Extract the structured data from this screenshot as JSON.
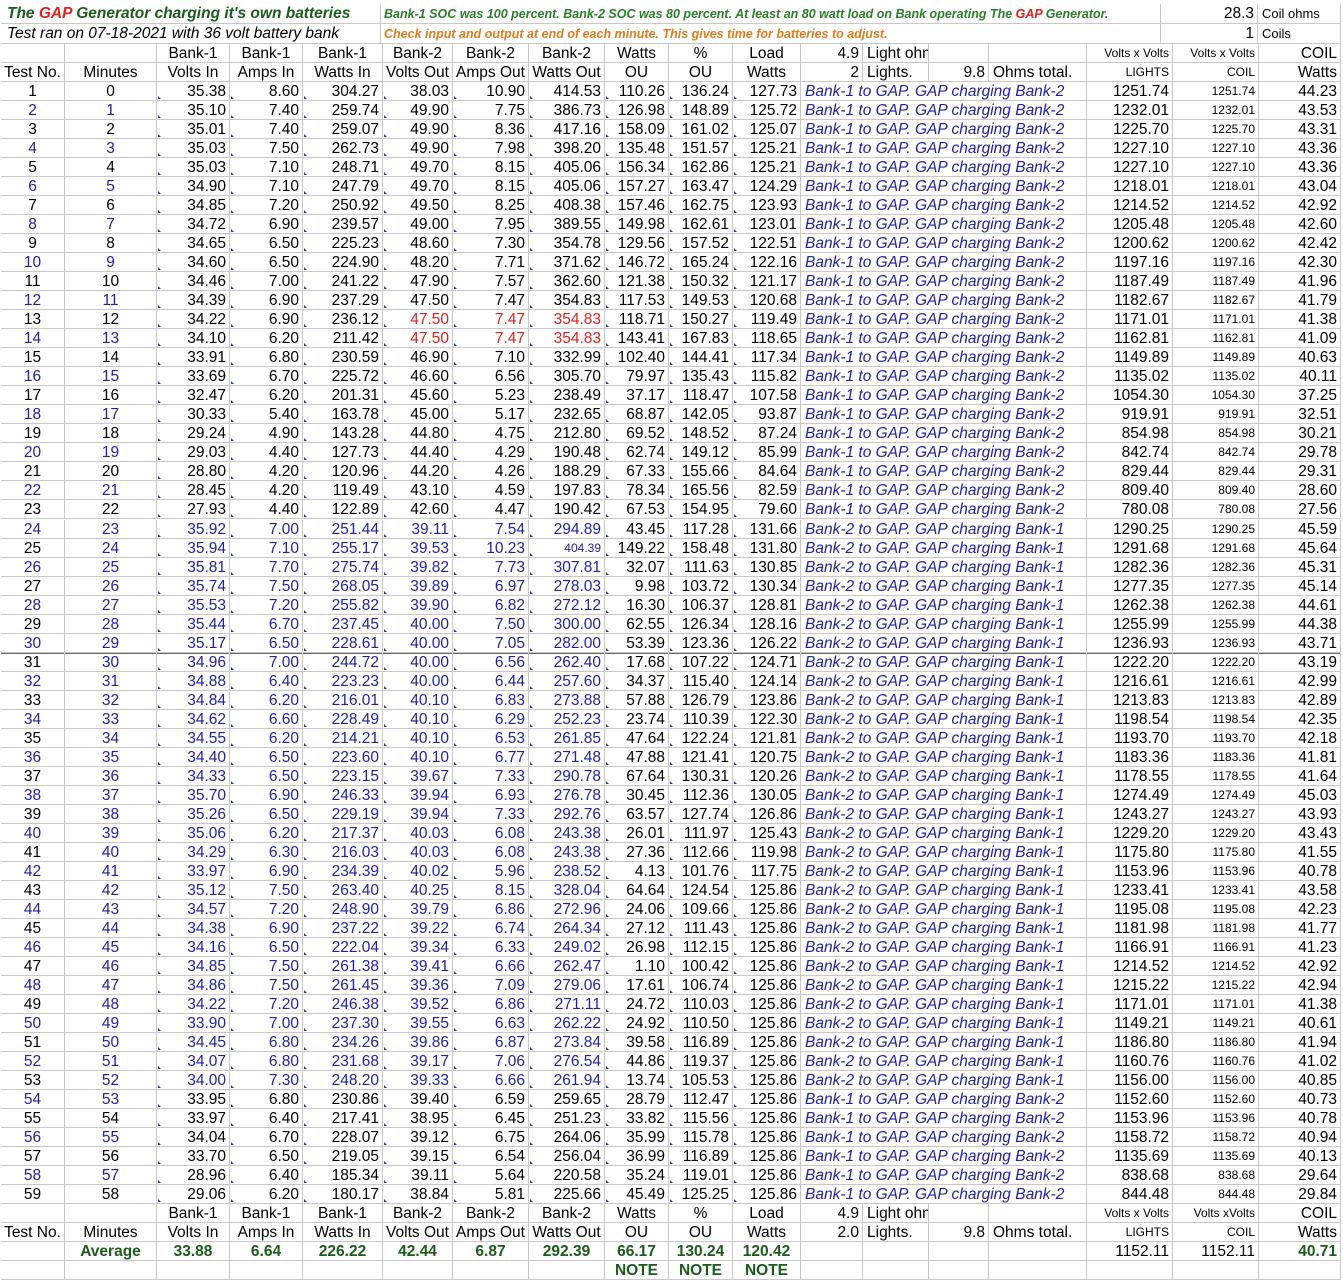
{
  "header": {
    "title_prefix": "The ",
    "title_gap": "GAP",
    "title_suffix": " Generator charging it's own batteries",
    "subtitle": "Test ran on 07-18-2021 with 36 volt battery bank",
    "note1_a": "Bank-1 SOC was 100 percent. Bank-2 SOC was 80 percent.  At least an 80 watt load on Bank operating The ",
    "note1_gap": "GAP",
    "note1_b": " Generator.",
    "note2": "Check input and output at end of each minute. This gives time for batteries to adjust.",
    "coil_ohms_value": "28.3",
    "coil_ohms_label": "Coil ohms",
    "coils_value": "1",
    "coils_label": "Coils"
  },
  "colheaders": {
    "top": [
      "",
      "",
      "Bank-1",
      "Bank-1",
      "Bank-1",
      "Bank-2",
      "Bank-2",
      "Bank-2",
      "Watts",
      "%",
      "Load",
      "4.9",
      "Light ohms.",
      "",
      "",
      "Volts x Volts",
      "Volts x Volts",
      "COIL"
    ],
    "bottom": [
      "Test No.",
      "Minutes",
      "Volts In",
      "Amps In",
      "Watts In",
      "Volts Out",
      "Amps Out",
      "Watts Out",
      "OU",
      "OU",
      "Watts",
      "2",
      "Lights.",
      "9.8",
      "Ohms total.",
      "LIGHTS",
      "COIL",
      "Watts"
    ]
  },
  "rows": [
    [
      "1",
      "0",
      "35.38",
      "8.60",
      "304.27",
      "38.03",
      "10.90",
      "414.53",
      "110.26",
      "136.24",
      "127.73",
      "Bank-1 to GAP. GAP charging Bank-2",
      "1251.74",
      "1251.74",
      "44.23"
    ],
    [
      "2",
      "1",
      "35.10",
      "7.40",
      "259.74",
      "49.90",
      "7.75",
      "386.73",
      "126.98",
      "148.89",
      "125.72",
      "Bank-1 to GAP. GAP charging Bank-2",
      "1232.01",
      "1232.01",
      "43.53"
    ],
    [
      "3",
      "2",
      "35.01",
      "7.40",
      "259.07",
      "49.90",
      "8.36",
      "417.16",
      "158.09",
      "161.02",
      "125.07",
      "Bank-1 to GAP. GAP charging Bank-2",
      "1225.70",
      "1225.70",
      "43.31"
    ],
    [
      "4",
      "3",
      "35.03",
      "7.50",
      "262.73",
      "49.90",
      "7.98",
      "398.20",
      "135.48",
      "151.57",
      "125.21",
      "Bank-1 to GAP. GAP charging Bank-2",
      "1227.10",
      "1227.10",
      "43.36"
    ],
    [
      "5",
      "4",
      "35.03",
      "7.10",
      "248.71",
      "49.70",
      "8.15",
      "405.06",
      "156.34",
      "162.86",
      "125.21",
      "Bank-1 to GAP. GAP charging Bank-2",
      "1227.10",
      "1227.10",
      "43.36"
    ],
    [
      "6",
      "5",
      "34.90",
      "7.10",
      "247.79",
      "49.70",
      "8.15",
      "405.06",
      "157.27",
      "163.47",
      "124.29",
      "Bank-1 to GAP. GAP charging Bank-2",
      "1218.01",
      "1218.01",
      "43.04"
    ],
    [
      "7",
      "6",
      "34.85",
      "7.20",
      "250.92",
      "49.50",
      "8.25",
      "408.38",
      "157.46",
      "162.75",
      "123.93",
      "Bank-1 to GAP. GAP charging Bank-2",
      "1214.52",
      "1214.52",
      "42.92"
    ],
    [
      "8",
      "7",
      "34.72",
      "6.90",
      "239.57",
      "49.00",
      "7.95",
      "389.55",
      "149.98",
      "162.61",
      "123.01",
      "Bank-1 to GAP. GAP charging Bank-2",
      "1205.48",
      "1205.48",
      "42.60"
    ],
    [
      "9",
      "8",
      "34.65",
      "6.50",
      "225.23",
      "48.60",
      "7.30",
      "354.78",
      "129.56",
      "157.52",
      "122.51",
      "Bank-1 to GAP. GAP charging Bank-2",
      "1200.62",
      "1200.62",
      "42.42"
    ],
    [
      "10",
      "9",
      "34.60",
      "6.50",
      "224.90",
      "48.20",
      "7.71",
      "371.62",
      "146.72",
      "165.24",
      "122.16",
      "Bank-1 to GAP. GAP charging Bank-2",
      "1197.16",
      "1197.16",
      "42.30"
    ],
    [
      "11",
      "10",
      "34.46",
      "7.00",
      "241.22",
      "47.90",
      "7.57",
      "362.60",
      "121.38",
      "150.32",
      "121.17",
      "Bank-1 to GAP. GAP charging Bank-2",
      "1187.49",
      "1187.49",
      "41.96"
    ],
    [
      "12",
      "11",
      "34.39",
      "6.90",
      "237.29",
      "47.50",
      "7.47",
      "354.83",
      "117.53",
      "149.53",
      "120.68",
      "Bank-1 to GAP. GAP charging Bank-2",
      "1182.67",
      "1182.67",
      "41.79"
    ],
    [
      "13",
      "12",
      "34.22",
      "6.90",
      "236.12",
      "47.50",
      "7.47",
      "354.83",
      "118.71",
      "150.27",
      "119.49",
      "Bank-1 to GAP. GAP charging Bank-2",
      "1171.01",
      "1171.01",
      "41.38"
    ],
    [
      "14",
      "13",
      "34.10",
      "6.20",
      "211.42",
      "47.50",
      "7.47",
      "354.83",
      "143.41",
      "167.83",
      "118.65",
      "Bank-1 to GAP. GAP charging Bank-2",
      "1162.81",
      "1162.81",
      "41.09"
    ],
    [
      "15",
      "14",
      "33.91",
      "6.80",
      "230.59",
      "46.90",
      "7.10",
      "332.99",
      "102.40",
      "144.41",
      "117.34",
      "Bank-1 to GAP. GAP charging Bank-2",
      "1149.89",
      "1149.89",
      "40.63"
    ],
    [
      "16",
      "15",
      "33.69",
      "6.70",
      "225.72",
      "46.60",
      "6.56",
      "305.70",
      "79.97",
      "135.43",
      "115.82",
      "Bank-1 to GAP. GAP charging Bank-2",
      "1135.02",
      "1135.02",
      "40.11"
    ],
    [
      "17",
      "16",
      "32.47",
      "6.20",
      "201.31",
      "45.60",
      "5.23",
      "238.49",
      "37.17",
      "118.47",
      "107.58",
      "Bank-1 to GAP. GAP charging Bank-2",
      "1054.30",
      "1054.30",
      "37.25"
    ],
    [
      "18",
      "17",
      "30.33",
      "5.40",
      "163.78",
      "45.00",
      "5.17",
      "232.65",
      "68.87",
      "142.05",
      "93.87",
      "Bank-1 to GAP. GAP charging Bank-2",
      "919.91",
      "919.91",
      "32.51"
    ],
    [
      "19",
      "18",
      "29.24",
      "4.90",
      "143.28",
      "44.80",
      "4.75",
      "212.80",
      "69.52",
      "148.52",
      "87.24",
      "Bank-1 to GAP. GAP charging Bank-2",
      "854.98",
      "854.98",
      "30.21"
    ],
    [
      "20",
      "19",
      "29.03",
      "4.40",
      "127.73",
      "44.40",
      "4.29",
      "190.48",
      "62.74",
      "149.12",
      "85.99",
      "Bank-1 to GAP. GAP charging Bank-2",
      "842.74",
      "842.74",
      "29.78"
    ],
    [
      "21",
      "20",
      "28.80",
      "4.20",
      "120.96",
      "44.20",
      "4.26",
      "188.29",
      "67.33",
      "155.66",
      "84.64",
      "Bank-1 to GAP. GAP charging Bank-2",
      "829.44",
      "829.44",
      "29.31"
    ],
    [
      "22",
      "21",
      "28.45",
      "4.20",
      "119.49",
      "43.10",
      "4.59",
      "197.83",
      "78.34",
      "165.56",
      "82.59",
      "Bank-1 to GAP. GAP charging Bank-2",
      "809.40",
      "809.40",
      "28.60"
    ],
    [
      "23",
      "22",
      "27.93",
      "4.40",
      "122.89",
      "42.60",
      "4.47",
      "190.42",
      "67.53",
      "154.95",
      "79.60",
      "Bank-1 to GAP. GAP charging Bank-2",
      "780.08",
      "780.08",
      "27.56"
    ],
    [
      "24",
      "23",
      "35.92",
      "7.00",
      "251.44",
      "39.11",
      "7.54",
      "294.89",
      "43.45",
      "117.28",
      "131.66",
      "Bank-2 to GAP. GAP charging Bank-1",
      "1290.25",
      "1290.25",
      "45.59"
    ],
    [
      "25",
      "24",
      "35.94",
      "7.10",
      "255.17",
      "39.53",
      "10.23",
      "404.39",
      "149.22",
      "158.48",
      "131.80",
      "Bank-2 to GAP. GAP charging Bank-1",
      "1291.68",
      "1291.68",
      "45.64"
    ],
    [
      "26",
      "25",
      "35.81",
      "7.70",
      "275.74",
      "39.82",
      "7.73",
      "307.81",
      "32.07",
      "111.63",
      "130.85",
      "Bank-2 to GAP. GAP charging Bank-1",
      "1282.36",
      "1282.36",
      "45.31"
    ],
    [
      "27",
      "26",
      "35.74",
      "7.50",
      "268.05",
      "39.89",
      "6.97",
      "278.03",
      "9.98",
      "103.72",
      "130.34",
      "Bank-2 to GAP. GAP charging Bank-1",
      "1277.35",
      "1277.35",
      "45.14"
    ],
    [
      "28",
      "27",
      "35.53",
      "7.20",
      "255.82",
      "39.90",
      "6.82",
      "272.12",
      "16.30",
      "106.37",
      "128.81",
      "Bank-2 to GAP. GAP charging Bank-1",
      "1262.38",
      "1262.38",
      "44.61"
    ],
    [
      "29",
      "28",
      "35.44",
      "6.70",
      "237.45",
      "40.00",
      "7.50",
      "300.00",
      "62.55",
      "126.34",
      "128.16",
      "Bank-2 to GAP. GAP charging Bank-1",
      "1255.99",
      "1255.99",
      "44.38"
    ],
    [
      "30",
      "29",
      "35.17",
      "6.50",
      "228.61",
      "40.00",
      "7.05",
      "282.00",
      "53.39",
      "123.36",
      "126.22",
      "Bank-2 to GAP. GAP charging Bank-1",
      "1236.93",
      "1236.93",
      "43.71"
    ],
    [
      "31",
      "30",
      "34.96",
      "7.00",
      "244.72",
      "40.00",
      "6.56",
      "262.40",
      "17.68",
      "107.22",
      "124.71",
      "Bank-2 to GAP. GAP charging Bank-1",
      "1222.20",
      "1222.20",
      "43.19"
    ],
    [
      "32",
      "31",
      "34.88",
      "6.40",
      "223.23",
      "40.00",
      "6.44",
      "257.60",
      "34.37",
      "115.40",
      "124.14",
      "Bank-2 to GAP. GAP charging Bank-1",
      "1216.61",
      "1216.61",
      "42.99"
    ],
    [
      "33",
      "32",
      "34.84",
      "6.20",
      "216.01",
      "40.10",
      "6.83",
      "273.88",
      "57.88",
      "126.79",
      "123.86",
      "Bank-2 to GAP. GAP charging Bank-1",
      "1213.83",
      "1213.83",
      "42.89"
    ],
    [
      "34",
      "33",
      "34.62",
      "6.60",
      "228.49",
      "40.10",
      "6.29",
      "252.23",
      "23.74",
      "110.39",
      "122.30",
      "Bank-2 to GAP. GAP charging Bank-1",
      "1198.54",
      "1198.54",
      "42.35"
    ],
    [
      "35",
      "34",
      "34.55",
      "6.20",
      "214.21",
      "40.10",
      "6.53",
      "261.85",
      "47.64",
      "122.24",
      "121.81",
      "Bank-2 to GAP. GAP charging Bank-1",
      "1193.70",
      "1193.70",
      "42.18"
    ],
    [
      "36",
      "35",
      "34.40",
      "6.50",
      "223.60",
      "40.10",
      "6.77",
      "271.48",
      "47.88",
      "121.41",
      "120.75",
      "Bank-2 to GAP. GAP charging Bank-1",
      "1183.36",
      "1183.36",
      "41.81"
    ],
    [
      "37",
      "36",
      "34.33",
      "6.50",
      "223.15",
      "39.67",
      "7.33",
      "290.78",
      "67.64",
      "130.31",
      "120.26",
      "Bank-2 to GAP. GAP charging Bank-1",
      "1178.55",
      "1178.55",
      "41.64"
    ],
    [
      "38",
      "37",
      "35.70",
      "6.90",
      "246.33",
      "39.94",
      "6.93",
      "276.78",
      "30.45",
      "112.36",
      "130.05",
      "Bank-2 to GAP. GAP charging Bank-1",
      "1274.49",
      "1274.49",
      "45.03"
    ],
    [
      "39",
      "38",
      "35.26",
      "6.50",
      "229.19",
      "39.94",
      "7.33",
      "292.76",
      "63.57",
      "127.74",
      "126.86",
      "Bank-2 to GAP. GAP charging Bank-1",
      "1243.27",
      "1243.27",
      "43.93"
    ],
    [
      "40",
      "39",
      "35.06",
      "6.20",
      "217.37",
      "40.03",
      "6.08",
      "243.38",
      "26.01",
      "111.97",
      "125.43",
      "Bank-2 to GAP. GAP charging Bank-1",
      "1229.20",
      "1229.20",
      "43.43"
    ],
    [
      "41",
      "40",
      "34.29",
      "6.30",
      "216.03",
      "40.03",
      "6.08",
      "243.38",
      "27.36",
      "112.66",
      "119.98",
      "Bank-2 to GAP. GAP charging Bank-1",
      "1175.80",
      "1175.80",
      "41.55"
    ],
    [
      "42",
      "41",
      "33.97",
      "6.90",
      "234.39",
      "40.02",
      "5.96",
      "238.52",
      "4.13",
      "101.76",
      "117.75",
      "Bank-2 to GAP. GAP charging Bank-1",
      "1153.96",
      "1153.96",
      "40.78"
    ],
    [
      "43",
      "42",
      "35.12",
      "7.50",
      "263.40",
      "40.25",
      "8.15",
      "328.04",
      "64.64",
      "124.54",
      "125.86",
      "Bank-2 to GAP. GAP charging Bank-1",
      "1233.41",
      "1233.41",
      "43.58"
    ],
    [
      "44",
      "43",
      "34.57",
      "7.20",
      "248.90",
      "39.79",
      "6.86",
      "272.96",
      "24.06",
      "109.66",
      "125.86",
      "Bank-2 to GAP. GAP charging Bank-1",
      "1195.08",
      "1195.08",
      "42.23"
    ],
    [
      "45",
      "44",
      "34.38",
      "6.90",
      "237.22",
      "39.22",
      "6.74",
      "264.34",
      "27.12",
      "111.43",
      "125.86",
      "Bank-2 to GAP. GAP charging Bank-1",
      "1181.98",
      "1181.98",
      "41.77"
    ],
    [
      "46",
      "45",
      "34.16",
      "6.50",
      "222.04",
      "39.34",
      "6.33",
      "249.02",
      "26.98",
      "112.15",
      "125.86",
      "Bank-2 to GAP. GAP charging Bank-1",
      "1166.91",
      "1166.91",
      "41.23"
    ],
    [
      "47",
      "46",
      "34.85",
      "7.50",
      "261.38",
      "39.41",
      "6.66",
      "262.47",
      "1.10",
      "100.42",
      "125.86",
      "Bank-2 to GAP. GAP charging Bank-1",
      "1214.52",
      "1214.52",
      "42.92"
    ],
    [
      "48",
      "47",
      "34.86",
      "7.50",
      "261.45",
      "39.36",
      "7.09",
      "279.06",
      "17.61",
      "106.74",
      "125.86",
      "Bank-2 to GAP. GAP charging Bank-1",
      "1215.22",
      "1215.22",
      "42.94"
    ],
    [
      "49",
      "48",
      "34.22",
      "7.20",
      "246.38",
      "39.52",
      "6.86",
      "271.11",
      "24.72",
      "110.03",
      "125.86",
      "Bank-2 to GAP. GAP charging Bank-1",
      "1171.01",
      "1171.01",
      "41.38"
    ],
    [
      "50",
      "49",
      "33.90",
      "7.00",
      "237.30",
      "39.55",
      "6.63",
      "262.22",
      "24.92",
      "110.50",
      "125.86",
      "Bank-2 to GAP. GAP charging Bank-1",
      "1149.21",
      "1149.21",
      "40.61"
    ],
    [
      "51",
      "50",
      "34.45",
      "6.80",
      "234.26",
      "39.86",
      "6.87",
      "273.84",
      "39.58",
      "116.89",
      "125.86",
      "Bank-2 to GAP. GAP charging Bank-1",
      "1186.80",
      "1186.80",
      "41.94"
    ],
    [
      "52",
      "51",
      "34.07",
      "6.80",
      "231.68",
      "39.17",
      "7.06",
      "276.54",
      "44.86",
      "119.37",
      "125.86",
      "Bank-2 to GAP. GAP charging Bank-1",
      "1160.76",
      "1160.76",
      "41.02"
    ],
    [
      "53",
      "52",
      "34.00",
      "7.30",
      "248.20",
      "39.33",
      "6.66",
      "261.94",
      "13.74",
      "105.53",
      "125.86",
      "Bank-2 to GAP. GAP charging Bank-1",
      "1156.00",
      "1156.00",
      "40.85"
    ],
    [
      "54",
      "53",
      "33.95",
      "6.80",
      "230.86",
      "39.40",
      "6.59",
      "259.65",
      "28.79",
      "112.47",
      "125.86",
      "Bank-1 to GAP. GAP charging Bank-2",
      "1152.60",
      "1152.60",
      "40.73"
    ],
    [
      "55",
      "54",
      "33.97",
      "6.40",
      "217.41",
      "38.95",
      "6.45",
      "251.23",
      "33.82",
      "115.56",
      "125.86",
      "Bank-1 to GAP. GAP charging Bank-2",
      "1153.96",
      "1153.96",
      "40.78"
    ],
    [
      "56",
      "55",
      "34.04",
      "6.70",
      "228.07",
      "39.12",
      "6.75",
      "264.06",
      "35.99",
      "115.78",
      "125.86",
      "Bank-1 to GAP. GAP charging Bank-2",
      "1158.72",
      "1158.72",
      "40.94"
    ],
    [
      "57",
      "56",
      "33.70",
      "6.50",
      "219.05",
      "39.15",
      "6.54",
      "256.04",
      "36.99",
      "116.89",
      "125.86",
      "Bank-1 to GAP. GAP charging Bank-2",
      "1135.69",
      "1135.69",
      "40.13"
    ],
    [
      "58",
      "57",
      "28.96",
      "6.40",
      "185.34",
      "39.11",
      "5.64",
      "220.58",
      "35.24",
      "119.01",
      "125.86",
      "Bank-1 to GAP. GAP charging Bank-2",
      "838.68",
      "838.68",
      "29.64"
    ],
    [
      "59",
      "58",
      "29.06",
      "6.20",
      "180.17",
      "38.84",
      "5.81",
      "225.66",
      "45.49",
      "125.25",
      "125.86",
      "Bank-1 to GAP. GAP charging Bank-2",
      "844.48",
      "844.48",
      "29.84"
    ]
  ],
  "footer": {
    "top": [
      "",
      "",
      "Bank-1",
      "Bank-1",
      "Bank-1",
      "Bank-2",
      "Bank-2",
      "Bank-2",
      "Watts",
      "%",
      "Load",
      "4.9",
      "Light ohms.",
      "",
      "",
      "Volts x Volts",
      "Volts xVolts",
      "COIL"
    ],
    "bottom": [
      "Test No.",
      "Minutes",
      "Volts In",
      "Amps In",
      "Watts In",
      "Volts Out",
      "Amps Out",
      "Watts Out",
      "OU",
      "OU",
      "Watts",
      "2.0",
      "Lights.",
      "9.8",
      "Ohms total.",
      "LIGHTS",
      "COIL",
      "Watts"
    ],
    "average": [
      "",
      "Average",
      "33.88",
      "6.64",
      "226.22",
      "42.44",
      "6.87",
      "292.39",
      "66.17",
      "130.24",
      "120.42",
      "",
      "",
      "",
      "",
      "1152.11",
      "1152.11",
      "40.71"
    ],
    "note": [
      "",
      "",
      "",
      "",
      "",
      "",
      "",
      "",
      "NOTE",
      "NOTE",
      "NOTE",
      "",
      "",
      "",
      "",
      "",
      "",
      ""
    ]
  },
  "colors": {
    "blue_text": "#1f1fa8",
    "red_text": "#e0201c",
    "green_text": "#1a5c1a",
    "note_orange": "#e07a1c",
    "note_green": "#2a7d2a"
  }
}
